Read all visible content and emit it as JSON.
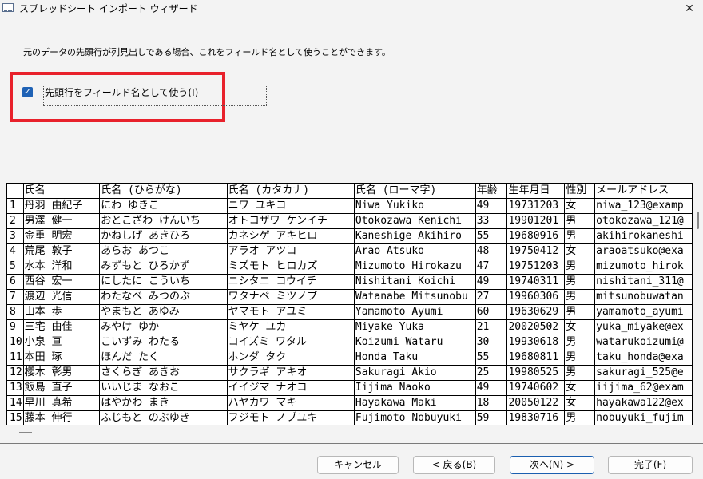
{
  "window": {
    "title": "スプレッドシート インポート ウィザード",
    "app_icon": "table-icon",
    "close_glyph": "✕"
  },
  "instruction": "元のデータの先頭行が列見出しである場合、これをフィールド名として使うことができます。",
  "first_row_checkbox": {
    "label": "先頭行をフィールド名として使う(I)",
    "checked": true,
    "check_glyph": "✓"
  },
  "accent_colors": {
    "highlight": "#e8212b",
    "checkbox": "#1f62b5",
    "primary_button_border": "#1b5fb0"
  },
  "preview": {
    "columns": [
      "",
      "氏名",
      "氏名 (ひらがな)",
      "氏名 (カタカナ)",
      "氏名 (ローマ字)",
      "年齢",
      "生年月日",
      "性別",
      "メールアドレス"
    ],
    "rows": [
      [
        "1",
        "丹羽 由紀子",
        "にわ ゆきこ",
        "ニワ ユキコ",
        "Niwa Yukiko",
        "49",
        "19731203",
        "女",
        "niwa_123@examp"
      ],
      [
        "2",
        "男澤 健一",
        "おとこざわ けんいち",
        "オトコザワ ケンイチ",
        "Otokozawa Kenichi",
        "33",
        "19901201",
        "男",
        "otokozawa_121@"
      ],
      [
        "3",
        "金重 明宏",
        "かねしげ あきひろ",
        "カネシゲ アキヒロ",
        "Kaneshige Akihiro",
        "55",
        "19680916",
        "男",
        "akihirokaneshi"
      ],
      [
        "4",
        "荒尾 敦子",
        "あらお あつこ",
        "アラオ アツコ",
        "Arao Atsuko",
        "48",
        "19750412",
        "女",
        "araoatsuko@exa"
      ],
      [
        "5",
        "水本 洋和",
        "みずもと ひろかず",
        "ミズモト ヒロカズ",
        "Mizumoto Hirokazu",
        "47",
        "19751203",
        "男",
        "mizumoto_hirok"
      ],
      [
        "6",
        "西谷 宏一",
        "にしたに こういち",
        "ニシタニ コウイチ",
        "Nishitani Koichi",
        "49",
        "19740311",
        "男",
        "nishitani_311@"
      ],
      [
        "7",
        "渡辺 光信",
        "わたなべ みつのぶ",
        "ワタナベ ミツノブ",
        "Watanabe Mitsunobu",
        "27",
        "19960306",
        "男",
        "mitsunobuwatan"
      ],
      [
        "8",
        "山本 歩",
        "やまもと あゆみ",
        "ヤマモト アユミ",
        "Yamamoto Ayumi",
        "60",
        "19630629",
        "男",
        "yamamoto_ayumi"
      ],
      [
        "9",
        "三宅 由佳",
        "みやけ ゆか",
        "ミヤケ ユカ",
        "Miyake Yuka",
        "21",
        "20020502",
        "女",
        "yuka_miyake@ex"
      ],
      [
        "10",
        "小泉 亘",
        "こいずみ わたる",
        "コイズミ ワタル",
        "Koizumi Wataru",
        "30",
        "19930618",
        "男",
        "watarukoizumi@"
      ],
      [
        "11",
        "本田 琢",
        "ほんだ たく",
        "ホンダ タク",
        "Honda Taku",
        "55",
        "19680811",
        "男",
        "taku_honda@exa"
      ],
      [
        "12",
        "櫻木 彰男",
        "さくらぎ あきお",
        "サクラギ アキオ",
        "Sakuragi Akio",
        "25",
        "19980525",
        "男",
        "sakuragi_525@e"
      ],
      [
        "13",
        "飯島 直子",
        "いいじま なおこ",
        "イイジマ ナオコ",
        "Iijima Naoko",
        "49",
        "19740602",
        "女",
        "iijima_62@exam"
      ],
      [
        "14",
        "早川 真希",
        "はやかわ まき",
        "ハヤカワ マキ",
        "Hayakawa Maki",
        "18",
        "20050122",
        "女",
        "hayakawa122@ex"
      ],
      [
        "15",
        "藤本 伸行",
        "ふじもと のぶゆき",
        "フジモト ノブユキ",
        "Fujimoto Nobuyuki",
        "59",
        "19830716",
        "男",
        "nobuyuki_fujim"
      ]
    ]
  },
  "buttons": {
    "cancel": "キャンセル",
    "back": "< 戻る(B)",
    "next": "次へ(N) >",
    "finish": "完了(F)"
  }
}
